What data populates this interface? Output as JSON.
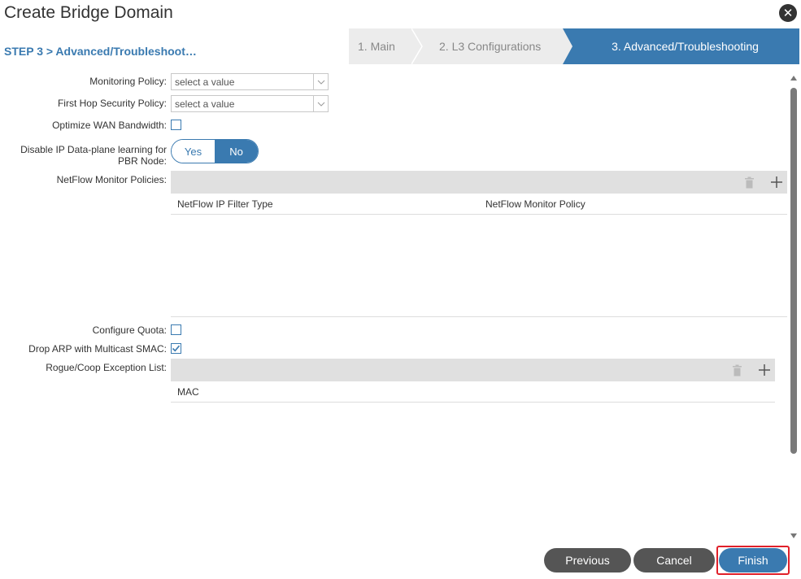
{
  "dialog": {
    "title": "Create Bridge Domain",
    "step_label": "STEP 3 > Advanced/Troubleshoot…"
  },
  "wizard": {
    "steps": [
      {
        "label": "1. Main",
        "active": false
      },
      {
        "label": "2. L3 Configurations",
        "active": false
      },
      {
        "label": "3. Advanced/Troubleshooting",
        "active": true
      }
    ]
  },
  "form": {
    "monitoring_policy": {
      "label": "Monitoring Policy:",
      "placeholder": "select a value"
    },
    "first_hop_security_policy": {
      "label": "First Hop Security Policy:",
      "placeholder": "select a value"
    },
    "optimize_wan_bandwidth": {
      "label": "Optimize WAN Bandwidth:",
      "checked": false
    },
    "disable_ip_learning": {
      "label_line1": "Disable IP Data-plane learning for",
      "label_line2": "PBR Node:",
      "yes_label": "Yes",
      "no_label": "No",
      "selected": "No"
    },
    "netflow_monitor_policies": {
      "label": "NetFlow Monitor Policies:",
      "columns": [
        "NetFlow IP Filter Type",
        "NetFlow Monitor Policy"
      ],
      "rows": []
    },
    "configure_quota": {
      "label": "Configure Quota:",
      "checked": false
    },
    "drop_arp": {
      "label": "Drop ARP with Multicast SMAC:",
      "checked": true
    },
    "rogue_coop_exception_list": {
      "label": "Rogue/Coop Exception List:",
      "columns": [
        "MAC"
      ],
      "rows": []
    }
  },
  "buttons": {
    "previous": "Previous",
    "cancel": "Cancel",
    "finish": "Finish"
  },
  "colors": {
    "accent": "#3a7ab0",
    "dark_button": "#555555",
    "highlight": "#e0202a"
  },
  "icons": {
    "close": "close-icon",
    "delete": "trash-icon",
    "add": "plus-icon",
    "dropdown": "chevron-down-icon"
  }
}
